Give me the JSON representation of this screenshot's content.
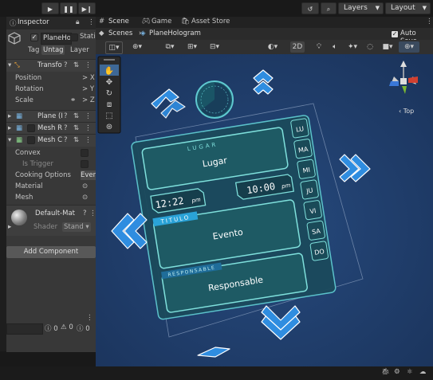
{
  "toolbar": {
    "layers_label": "Layers",
    "layout_label": "Layout"
  },
  "inspector": {
    "tab_label": "Inspector",
    "object_name": "PlaneHo",
    "static_label": "Static",
    "tag_label": "Tag",
    "tag_value": "Untag",
    "layer_label": "Layer",
    "transform": {
      "title": "Transfo",
      "position_label": "Position",
      "rotation_label": "Rotation",
      "scale_label": "Scale",
      "x_char": "X",
      "y_char": "Y",
      "z_char": "Z"
    },
    "components": [
      {
        "title": "Plane (I"
      },
      {
        "title": "Mesh R"
      },
      {
        "title": "Mesh C"
      }
    ],
    "mesh_collider": {
      "convex_label": "Convex",
      "is_trigger_label": "Is Trigger",
      "cooking_label": "Cooking Options",
      "cooking_value": "Even",
      "material_label": "Material",
      "mesh_label": "Mesh"
    },
    "material": {
      "name": "Default-Mat",
      "shader_label": "Shader",
      "shader_value": "Stand"
    },
    "add_component_label": "Add Component"
  },
  "console": {
    "count_errors": "0",
    "count_warnings": "0",
    "count_logs": "0"
  },
  "scene": {
    "tabs": [
      {
        "label": "Scene"
      },
      {
        "label": "Game"
      },
      {
        "label": "Asset Store"
      }
    ],
    "breadcrumb_root": "Scenes",
    "breadcrumb_item": "PlaneHologram",
    "auto_save_label": "Auto Save",
    "mode_2d": "2D",
    "gizmo_view_label": "Top"
  },
  "hologram": {
    "lugar_header": "LUGAR",
    "lugar_text": "Lugar",
    "time_start": "12:22",
    "time_start_suffix": "pm",
    "time_end": "10:00",
    "time_end_suffix": "pm",
    "titulo_header": "TITULO",
    "evento_text": "Evento",
    "responsable_header": "RESPONSABLE",
    "responsable_text": "Responsable",
    "days": [
      "LU",
      "MA",
      "MI",
      "JU",
      "VI",
      "SA",
      "DO"
    ]
  },
  "colors": {
    "viewport_bg": "#1f3a66",
    "holo_teal": "#7fe0dc",
    "holo_panel": "#1e5a64",
    "holo_blue_arrow": "#2f8de0",
    "titulo_bar": "#2aa3d8"
  }
}
